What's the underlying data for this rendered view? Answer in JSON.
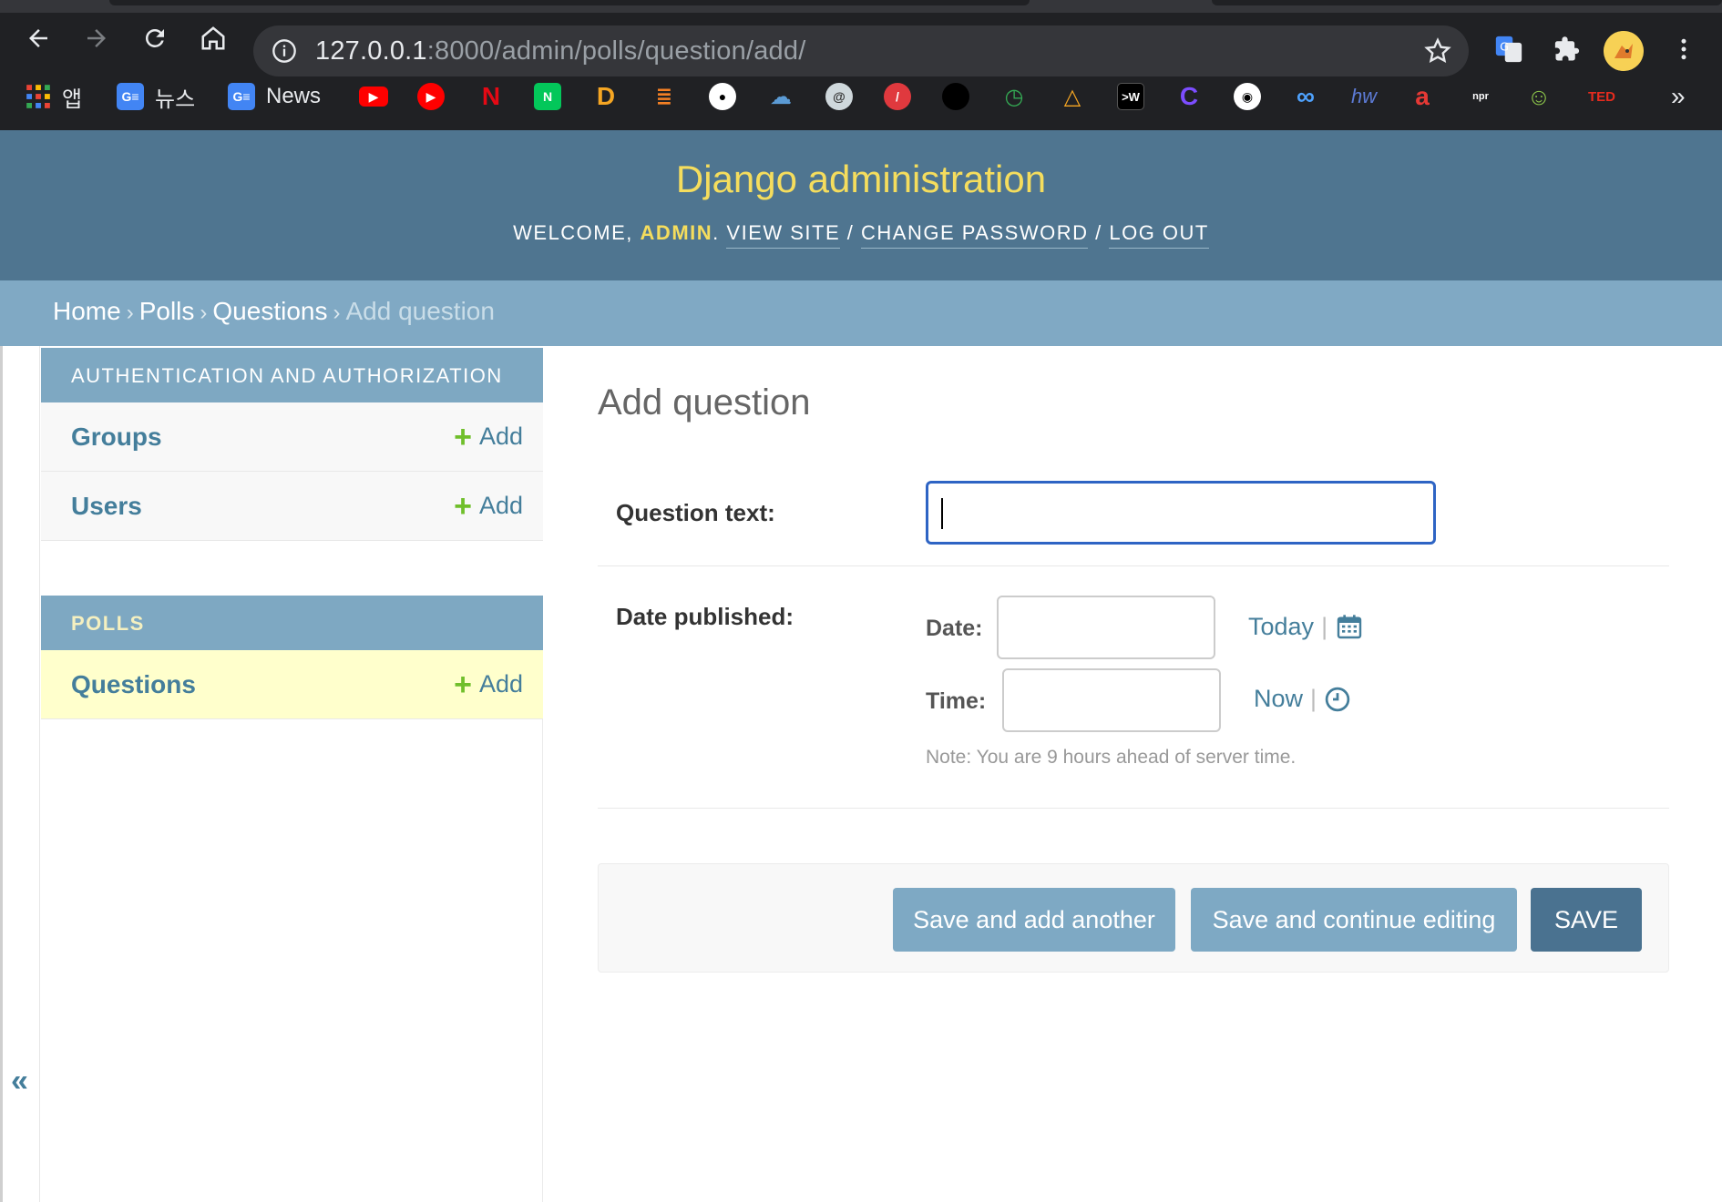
{
  "browser": {
    "url_host": "127.0.0.1",
    "url_rest": ":8000/admin/polls/question/add/",
    "bookmarks": [
      {
        "label": "앱",
        "icon": "apps-grid-icon"
      },
      {
        "label": "뉴스",
        "icon": "google-news-icon"
      },
      {
        "label": "News",
        "icon": "google-news-icon"
      }
    ],
    "bookmark_icons": [
      "youtube-icon",
      "youtube-music-icon",
      "netflix-icon",
      "naver-icon",
      "d-icon",
      "stackoverflow-icon",
      "github-icon",
      "cloud-icon",
      "swirl-icon",
      "ball-icon",
      "circle-icon",
      "clock-icon",
      "triangle-icon",
      "terminal-icon",
      "c-icon",
      "ninja-icon",
      "infinity-icon",
      "handwriting-icon",
      "a-icon",
      "npr-icon",
      "person-icon",
      "ted-icon"
    ],
    "bm_text": {
      "terminal": ">W",
      "npr": "npr",
      "ted": "TED"
    },
    "more": "»"
  },
  "header": {
    "branding": "Django administration",
    "welcome": "WELCOME,",
    "username": "ADMIN",
    "view_site": "VIEW SITE",
    "change_password": "CHANGE PASSWORD",
    "log_out": "LOG OUT",
    "sep": "/",
    "dot": "."
  },
  "breadcrumbs": {
    "home": "Home",
    "polls": "Polls",
    "questions": "Questions",
    "current": "Add question",
    "sep": "›"
  },
  "sidebar": {
    "modules": [
      {
        "caption": "AUTHENTICATION AND AUTHORIZATION",
        "rows": [
          {
            "name": "Groups",
            "add": "Add"
          },
          {
            "name": "Users",
            "add": "Add"
          }
        ]
      },
      {
        "caption": "POLLS",
        "rows": [
          {
            "name": "Questions",
            "add": "Add"
          }
        ]
      }
    ],
    "plus": "+",
    "collapse": "«"
  },
  "content": {
    "title": "Add question",
    "question_text_label": "Question text:",
    "question_text_value": "",
    "date_published_label": "Date published:",
    "date_label": "Date:",
    "time_label": "Time:",
    "date_value": "",
    "time_value": "",
    "today": "Today",
    "now": "Now",
    "pipe": "|",
    "note": "Note: You are 9 hours ahead of server time."
  },
  "buttons": {
    "save_add_another": "Save and add another",
    "save_continue": "Save and continue editing",
    "save": "SAVE"
  },
  "colors": {
    "header_bg": "#4f7590",
    "branding": "#f5dd5d",
    "breadcrumbs_bg": "#80a9c4",
    "module_caption": "#7ea8c2",
    "link": "#447e9b",
    "add_plus": "#70bf2b",
    "selected_row": "#ffffcc",
    "focus_border": "#2e64c4"
  }
}
